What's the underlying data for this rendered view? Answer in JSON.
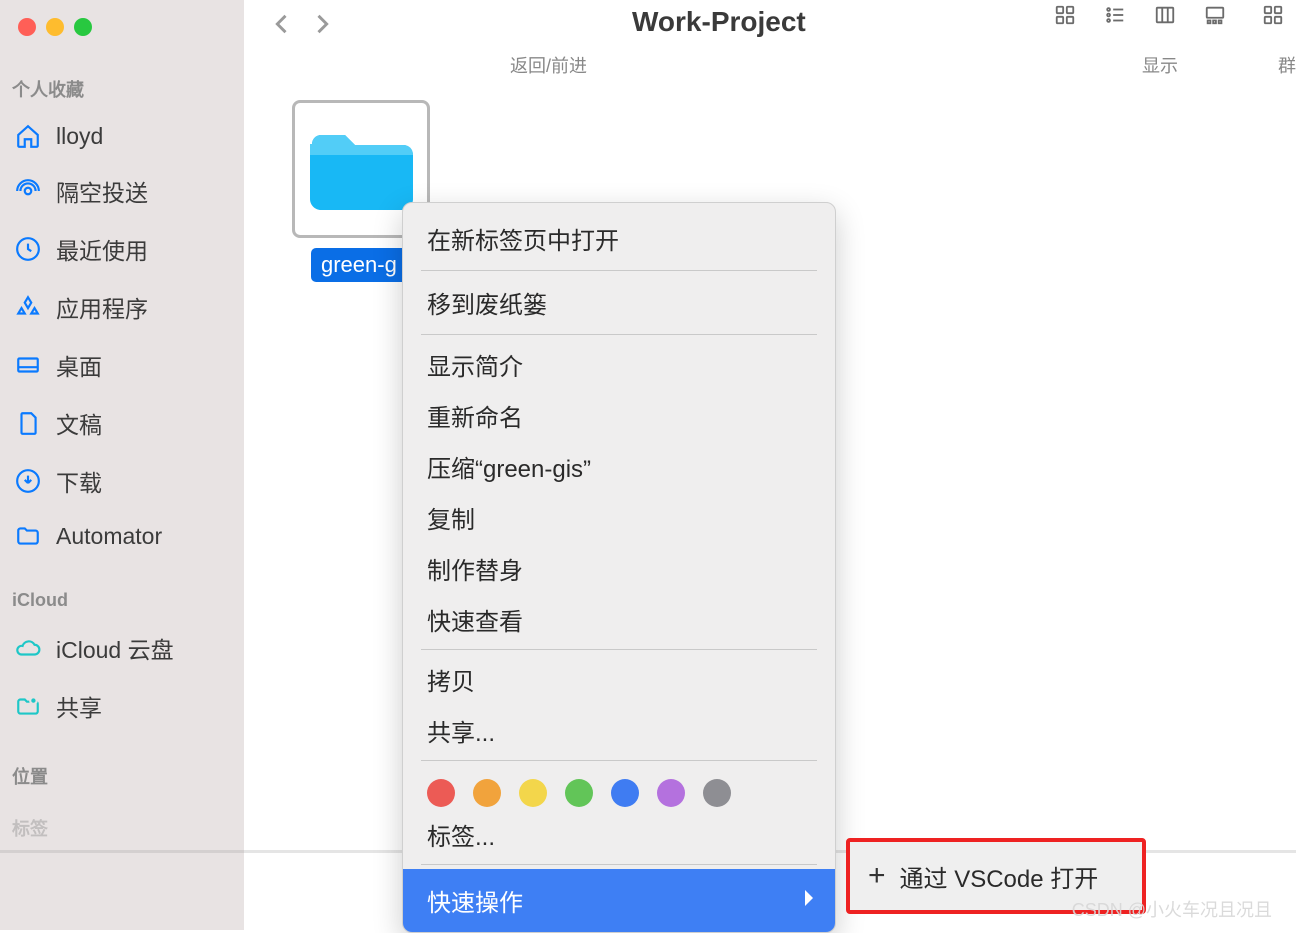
{
  "window": {
    "title": "Work-Project"
  },
  "toolbar": {
    "nav_label": "返回/前进",
    "view_label": "显示",
    "group_label": "群"
  },
  "sidebar": {
    "section_favorites_title": "个人收藏",
    "favorites": [
      {
        "label": "lloyd",
        "icon": "home"
      },
      {
        "label": "隔空投送",
        "icon": "airdrop"
      },
      {
        "label": "最近使用",
        "icon": "clock"
      },
      {
        "label": "应用程序",
        "icon": "apps"
      },
      {
        "label": "桌面",
        "icon": "desktop"
      },
      {
        "label": "文稿",
        "icon": "document"
      },
      {
        "label": "下载",
        "icon": "downloads"
      },
      {
        "label": "Automator",
        "icon": "folder"
      }
    ],
    "section_icloud_title": "iCloud",
    "icloud_items": [
      {
        "label": "iCloud 云盘",
        "icon": "cloud"
      },
      {
        "label": "共享",
        "icon": "share-folder"
      }
    ],
    "section_locations_title": "位置",
    "section_tags_title": "标签"
  },
  "content": {
    "selected_folder_name": "green-g"
  },
  "context_menu": {
    "items_group1": [
      "在新标签页中打开"
    ],
    "items_group2": [
      "移到废纸篓"
    ],
    "items_group3": [
      "显示简介",
      "重新命名",
      "压缩“green-gis”",
      "复制",
      "制作替身",
      "快速查看"
    ],
    "items_group4": [
      "拷贝",
      "共享..."
    ],
    "tag_colors": [
      "#ec5b55",
      "#f1a33c",
      "#f3d64b",
      "#62c558",
      "#3f7cf2",
      "#b471de",
      "#8e8e93"
    ],
    "tags_label": "标签...",
    "quick_actions_label": "快速操作"
  },
  "submenu": {
    "open_with_vscode": "通过 VSCode 打开"
  },
  "watermark": "CSDN @小火车况且况且"
}
